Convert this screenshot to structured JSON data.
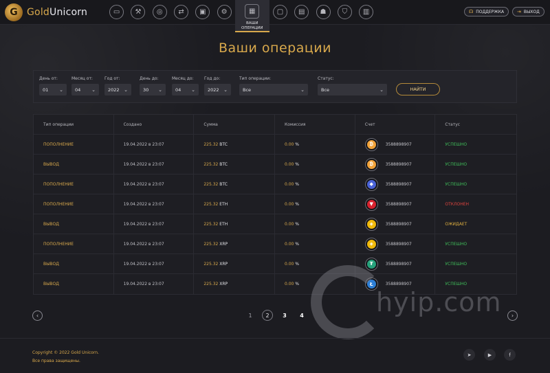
{
  "app": {
    "logo_mark": "G",
    "logo_gold": "Gold",
    "logo_white": "Unicorn"
  },
  "nav": {
    "icons": [
      {
        "name": "monitor-icon",
        "glyph": "▭"
      },
      {
        "name": "tools-icon",
        "glyph": "⚒"
      },
      {
        "name": "coins-icon",
        "glyph": "◎"
      },
      {
        "name": "transfer-icon",
        "glyph": "⇄"
      },
      {
        "name": "wallet-icon",
        "glyph": "▣"
      },
      {
        "name": "gear-icon",
        "glyph": "⚙"
      },
      {
        "name": "calendar-icon",
        "glyph": "▦"
      },
      {
        "name": "display-icon",
        "glyph": "▢"
      },
      {
        "name": "briefcase-icon",
        "glyph": "▤"
      },
      {
        "name": "users-icon",
        "glyph": "☗"
      },
      {
        "name": "shield-icon",
        "glyph": "⛉"
      },
      {
        "name": "document-icon",
        "glyph": "▥"
      }
    ],
    "active_label_1": "Ваши",
    "active_label_2": "операции",
    "support_label": "ПОДДЕРЖКА",
    "logout_label": "ВЫХОД"
  },
  "page": {
    "title": "Ваши операции"
  },
  "filter": {
    "day_from": {
      "label": "День от:",
      "value": "01"
    },
    "month_from": {
      "label": "Месяц от:",
      "value": "04"
    },
    "year_from": {
      "label": "Год от:",
      "value": "2022"
    },
    "day_to": {
      "label": "День до:",
      "value": "30"
    },
    "month_to": {
      "label": "Месяц до:",
      "value": "04"
    },
    "year_to": {
      "label": "Год до:",
      "value": "2022"
    },
    "op_type": {
      "label": "Тип операции:",
      "value": "Все"
    },
    "status": {
      "label": "Статус:",
      "value": "Все"
    },
    "find_label": "НАЙТИ"
  },
  "table": {
    "headers": [
      "Тип операции",
      "Создано",
      "Сумма",
      "Комиссия",
      "Счет",
      "Статус"
    ],
    "rows": [
      {
        "type": "Пополнение",
        "created": "19.04.2022 в 23:07",
        "amount": "225.32",
        "currency": "BTC",
        "fee": "0.00",
        "fee_unit": "%",
        "coin": "bitcoin",
        "coin_color": "#f2a33a",
        "coin_glyph": "₿",
        "account": "3588898907",
        "status": "Успешно",
        "status_kind": "ok"
      },
      {
        "type": "Вывод",
        "created": "19.04.2022 в 23:07",
        "amount": "225.32",
        "currency": "BTC",
        "fee": "0.00",
        "fee_unit": "%",
        "coin": "bitcoin",
        "coin_color": "#f2a33a",
        "coin_glyph": "₿",
        "account": "3588898907",
        "status": "Успешно",
        "status_kind": "ok"
      },
      {
        "type": "Пополнение",
        "created": "19.04.2022 в 23:07",
        "amount": "225.32",
        "currency": "BTC",
        "fee": "0.00",
        "fee_unit": "%",
        "coin": "ethereum",
        "coin_color": "#4a63d8",
        "coin_glyph": "◆",
        "account": "3588898907",
        "status": "Успешно",
        "status_kind": "ok"
      },
      {
        "type": "Пополнение",
        "created": "19.04.2022 в 23:07",
        "amount": "225.32",
        "currency": "ETH",
        "fee": "0.00",
        "fee_unit": "%",
        "coin": "tron",
        "coin_color": "#d8232f",
        "coin_glyph": "▼",
        "account": "3588898907",
        "status": "Отклонен",
        "status_kind": "bad"
      },
      {
        "type": "Вывод",
        "created": "19.04.2022 в 23:07",
        "amount": "225.32",
        "currency": "ETH",
        "fee": "0.00",
        "fee_unit": "%",
        "coin": "binance",
        "coin_color": "#f0b90b",
        "coin_glyph": "◈",
        "account": "3588898907",
        "status": "Ожидает",
        "status_kind": "wait"
      },
      {
        "type": "Пополнение",
        "created": "19.04.2022 в 23:07",
        "amount": "225.32",
        "currency": "XRP",
        "fee": "0.00",
        "fee_unit": "%",
        "coin": "binance",
        "coin_color": "#f0b90b",
        "coin_glyph": "◈",
        "account": "3588898907",
        "status": "Успешно",
        "status_kind": "ok"
      },
      {
        "type": "Вывод",
        "created": "19.04.2022 в 23:07",
        "amount": "225.32",
        "currency": "XRP",
        "fee": "0.00",
        "fee_unit": "%",
        "coin": "tether",
        "coin_color": "#26a17b",
        "coin_glyph": "₮",
        "account": "3588898907",
        "status": "Успешно",
        "status_kind": "ok"
      },
      {
        "type": "Вывод",
        "created": "19.04.2022 в 23:07",
        "amount": "225.32",
        "currency": "XRP",
        "fee": "0.00",
        "fee_unit": "%",
        "coin": "litecoin",
        "coin_color": "#2e7fd6",
        "coin_glyph": "Ł",
        "account": "3588898907",
        "status": "Успешно",
        "status_kind": "ok"
      }
    ]
  },
  "pagination": {
    "prev": "‹",
    "next": "›",
    "pages": [
      "1",
      "2",
      "3",
      "4"
    ],
    "current": "2"
  },
  "watermark": {
    "text": "hyip.com"
  },
  "footer": {
    "copyright": "Copyright © 2022 Gold Unicorn.",
    "rights": "Все права защищены.",
    "social": [
      {
        "name": "telegram-icon",
        "glyph": "➤"
      },
      {
        "name": "youtube-icon",
        "glyph": "▶"
      },
      {
        "name": "facebook-icon",
        "glyph": "f"
      }
    ]
  }
}
